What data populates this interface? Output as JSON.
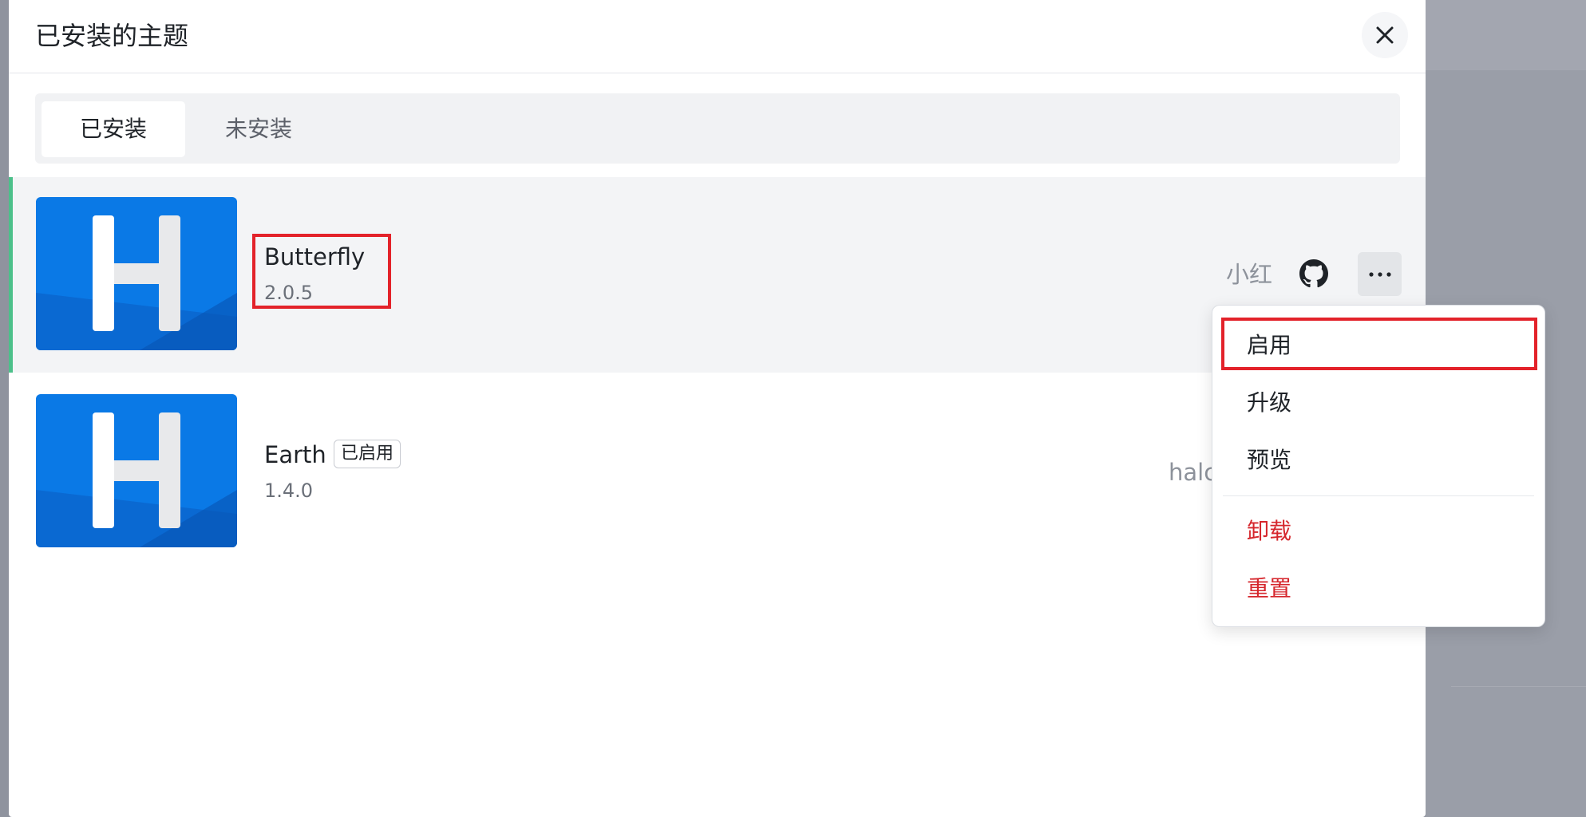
{
  "modal": {
    "title": "已安装的主题"
  },
  "tabs": [
    {
      "label": "已安装",
      "active": true
    },
    {
      "label": "未安装",
      "active": false
    }
  ],
  "themes": [
    {
      "name": "Butterfly",
      "version": "2.0.5",
      "author": "小红",
      "badge": ""
    },
    {
      "name": "Earth",
      "version": "1.4.0",
      "author": "halc",
      "badge": "已启用"
    }
  ],
  "menu": {
    "items": [
      {
        "label": "启用",
        "danger": false
      },
      {
        "label": "升级",
        "danger": false
      },
      {
        "label": "预览",
        "danger": false
      },
      {
        "label": "卸载",
        "danger": true
      },
      {
        "label": "重置",
        "danger": true
      }
    ]
  },
  "icons": [
    "close-icon",
    "github-icon",
    "more-icon",
    "theme-logo-icon"
  ],
  "colors": {
    "accent_bar": "#4cc08a",
    "danger": "#d5262c",
    "annotation": "#e3222a",
    "logo_blue": "#0a79e6"
  }
}
